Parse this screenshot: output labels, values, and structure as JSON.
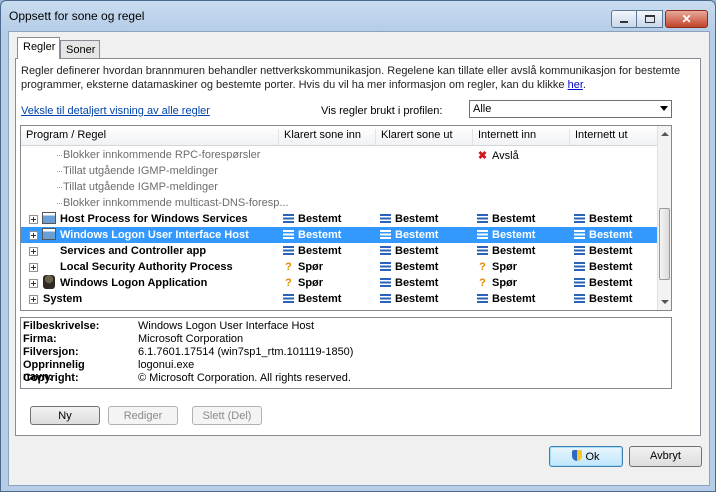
{
  "window": {
    "title": "Oppsett for sone og regel"
  },
  "tabs": [
    {
      "label": "Regler"
    },
    {
      "label": "Soner"
    }
  ],
  "description": {
    "text": "Regler definerer hvordan brannmuren behandler nettverkskommunikasjon. Regelene kan tillate eller avslå kommunikasjon for bestemte programmer, eksterne datamaskiner og bestemte porter. Hvis du vil ha mer informasjon om regler, kan du klikke ",
    "link": "her",
    "after": "."
  },
  "detail_link": "Veksle til detaljert visning av alle regler",
  "profile": {
    "label": "Vis regler brukt i profilen:",
    "value": "Alle"
  },
  "columns": [
    "Program / Regel",
    "Klarert sone inn",
    "Klarert sone ut",
    "Internett inn",
    "Internett ut"
  ],
  "rows": [
    {
      "name": "Blokker innkommende RPC-forespørsler",
      "cells": [
        "",
        "",
        "Avslå",
        ""
      ]
    },
    {
      "name": "Tillat utgående IGMP-meldinger",
      "cells": [
        "",
        "",
        "",
        ""
      ]
    },
    {
      "name": "Tillat utgående IGMP-meldinger",
      "cells": [
        "",
        "",
        "",
        ""
      ]
    },
    {
      "name": "Blokker innkommende multicast-DNS-foresp...",
      "cells": [
        "",
        "",
        "",
        ""
      ]
    },
    {
      "name": "Host Process for Windows Services",
      "cells": [
        "Bestemt",
        "Bestemt",
        "Bestemt",
        "Bestemt"
      ]
    },
    {
      "name": "Windows Logon User Interface Host",
      "cells": [
        "Bestemt",
        "Bestemt",
        "Bestemt",
        "Bestemt"
      ]
    },
    {
      "name": "Services and Controller app",
      "cells": [
        "Bestemt",
        "Bestemt",
        "Bestemt",
        "Bestemt"
      ]
    },
    {
      "name": "Local Security Authority Process",
      "cells": [
        "Spør",
        "Bestemt",
        "Spør",
        "Bestemt"
      ]
    },
    {
      "name": "Windows Logon Application",
      "cells": [
        "Spør",
        "Bestemt",
        "Spør",
        "Bestemt"
      ]
    },
    {
      "name": "System",
      "cells": [
        "Bestemt",
        "Bestemt",
        "Bestemt",
        "Bestemt"
      ]
    }
  ],
  "details": [
    {
      "label": "Filbeskrivelse:",
      "value": "Windows Logon User Interface Host"
    },
    {
      "label": "Firma:",
      "value": "Microsoft Corporation"
    },
    {
      "label": "Filversjon:",
      "value": "6.1.7601.17514 (win7sp1_rtm.101119-1850)"
    },
    {
      "label": "Opprinnelig navn:",
      "value": "logonui.exe"
    },
    {
      "label": "Copyright:",
      "value": "© Microsoft Corporation. All rights reserved."
    }
  ],
  "buttons": {
    "new": "Ny",
    "edit": "Rediger",
    "delete": "Slett (Del)",
    "ok": "Ok",
    "cancel": "Avbryt"
  }
}
